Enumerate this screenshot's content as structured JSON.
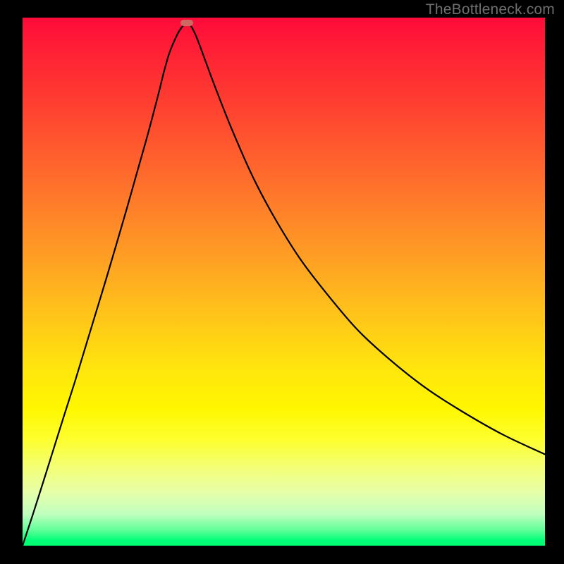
{
  "watermark": "TheBottleneck.com",
  "colors": {
    "frame": "#000000",
    "curve": "#000000",
    "marker": "#cf6a63",
    "gradient_top": "#ff0a3a",
    "gradient_bottom": "#00ff6d"
  },
  "chart_data": {
    "type": "line",
    "title": "",
    "xlabel": "",
    "ylabel": "",
    "xlim": [
      0,
      100
    ],
    "ylim": [
      0,
      100
    ],
    "grid": false,
    "marker": {
      "x_pct": 31.5,
      "y_pct": 99.0
    },
    "series": [
      {
        "name": "bottleneck-curve",
        "x_pct": [
          0,
          2,
          4,
          6,
          8,
          10,
          12,
          14,
          16,
          18,
          20,
          22,
          24,
          26,
          27,
          28,
          29,
          30,
          31,
          31.5,
          32,
          33,
          34,
          35,
          37,
          40,
          44,
          48,
          53,
          58,
          64,
          70,
          77,
          84,
          92,
          100
        ],
        "y_pct": [
          0,
          6,
          12.2,
          18.5,
          24.8,
          31,
          37.5,
          44,
          50.5,
          57.2,
          64,
          71,
          78,
          85.5,
          89.5,
          93,
          95.5,
          97.5,
          98.8,
          99.3,
          98.8,
          97,
          94.5,
          91.8,
          86.5,
          79,
          70,
          62.5,
          54.5,
          48,
          41,
          35.5,
          30,
          25.5,
          21,
          17.3
        ]
      }
    ],
    "annotations": []
  }
}
